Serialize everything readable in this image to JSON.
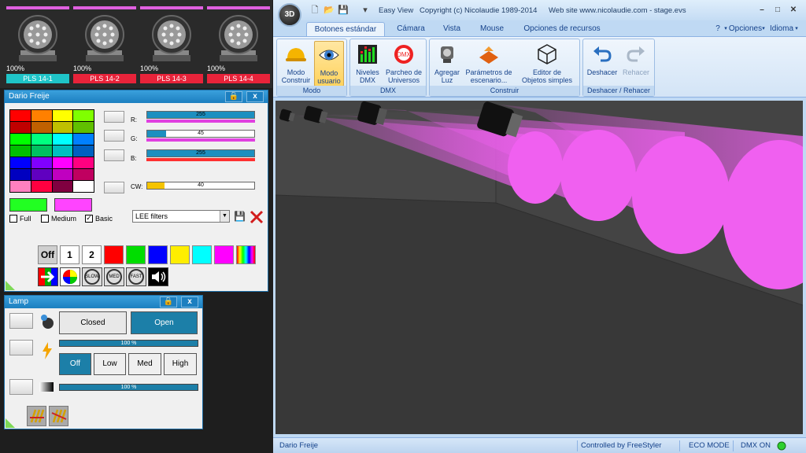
{
  "fixtures": [
    {
      "percent": "100%",
      "label": "PLS 14-1",
      "label_color": "#1fc4c8"
    },
    {
      "percent": "100%",
      "label": "PLS 14-2",
      "label_color": "#e8233a"
    },
    {
      "percent": "100%",
      "label": "PLS 14-3",
      "label_color": "#e8233a"
    },
    {
      "percent": "100%",
      "label": "PLS 14-4",
      "label_color": "#e8233a"
    }
  ],
  "color_panel": {
    "title": "Dario Freije",
    "swatches": [
      "#ff0000",
      "#ff8000",
      "#ffff00",
      "#80ff00",
      "#c00000",
      "#c06000",
      "#c0c000",
      "#60c000",
      "#00ff00",
      "#00ff80",
      "#00ffff",
      "#0080ff",
      "#00c000",
      "#00c060",
      "#00c0c0",
      "#0060c0",
      "#0000ff",
      "#8000ff",
      "#ff00ff",
      "#ff0080",
      "#0000c0",
      "#6000c0",
      "#c000c0",
      "#c00060",
      "#ff80c0",
      "#ff0040",
      "#800040",
      "#ffffff"
    ],
    "current_color": "#22ff22",
    "target_color": "#ff44ff",
    "channels": [
      {
        "label": "R:",
        "value": "255",
        "level": 1.0,
        "bar_color": "#e040e0"
      },
      {
        "label": "G:",
        "value": "45",
        "level": 0.18,
        "bar_color": "#e040e0"
      },
      {
        "label": "B:",
        "value": "255",
        "level": 1.0,
        "bar_color": "#ff3030"
      },
      {
        "label": "CW:",
        "value": "40",
        "level": 0.16,
        "bar_color": "#f5c400"
      }
    ],
    "checkboxes": [
      {
        "label": "Full",
        "checked": ""
      },
      {
        "label": "Medium",
        "checked": ""
      },
      {
        "label": "Basic",
        "checked": "✓"
      }
    ],
    "filter_select": "LEE filters",
    "quick_buttons": [
      {
        "label": "Off",
        "bg": "#cfcfcf"
      },
      {
        "label": "1",
        "bg": "#ffffff"
      },
      {
        "label": "2",
        "bg": "#ffffff"
      },
      {
        "label": "",
        "bg": "#ff0000"
      },
      {
        "label": "",
        "bg": "#00dd00"
      },
      {
        "label": "",
        "bg": "#0000ff"
      },
      {
        "label": "",
        "bg": "#ffee00"
      },
      {
        "label": "",
        "bg": "#00ffff"
      },
      {
        "label": "",
        "bg": "#ff00ff"
      }
    ],
    "effect_buttons": [
      {
        "label": "",
        "name": "strobe-arrow-icon"
      },
      {
        "label": "",
        "name": "color-wheel-icon"
      },
      {
        "label": "SLOW",
        "name": "slow-icon"
      },
      {
        "label": "MED",
        "name": "med-icon"
      },
      {
        "label": "FAST",
        "name": "fast-icon"
      },
      {
        "label": "",
        "name": "sound-icon"
      }
    ]
  },
  "lamp_panel": {
    "title": "Lamp",
    "closed": "Closed",
    "open": "Open",
    "dimmer": "100 %",
    "off": "Off",
    "low": "Low",
    "med": "Med",
    "high": "High",
    "shutter": "100 %"
  },
  "main": {
    "logo": "3D",
    "title": "Easy View",
    "copyright": "Copyright (c) Nicolaudie 1989-2014",
    "website": "Web site www.nicolaudie.com - stage.evs",
    "tabs": [
      "Botones estándar",
      "Cámara",
      "Vista",
      "Mouse",
      "Opciones de recursos"
    ],
    "help": "?",
    "options": "Opciones",
    "language": "Idioma",
    "groups": [
      {
        "name": "Modo",
        "buttons": [
          {
            "label1": "Modo",
            "label2": "Construir"
          },
          {
            "label1": "Modo",
            "label2": "usuario"
          }
        ]
      },
      {
        "name": "DMX",
        "buttons": [
          {
            "label1": "Niveles",
            "label2": "DMX"
          },
          {
            "label1": "Parcheo de",
            "label2": "Universos"
          }
        ]
      },
      {
        "name": "Construir",
        "buttons": [
          {
            "label1": "Agregar",
            "label2": "Luz"
          },
          {
            "label1": "Parámetros de",
            "label2": "escenario..."
          },
          {
            "label1": "Editor de",
            "label2": "Objetos simples"
          }
        ]
      },
      {
        "name": "Deshacer / Rehacer",
        "buttons": [
          {
            "label1": "Deshacer",
            "label2": ""
          },
          {
            "label1": "Rehacer",
            "label2": ""
          }
        ]
      }
    ],
    "status": {
      "user": "Dario Freije",
      "controlled": "Controlled by FreeStyler",
      "eco": "ECO MODE",
      "dmx": "DMX ON"
    },
    "beam_color": "#f060f0"
  }
}
